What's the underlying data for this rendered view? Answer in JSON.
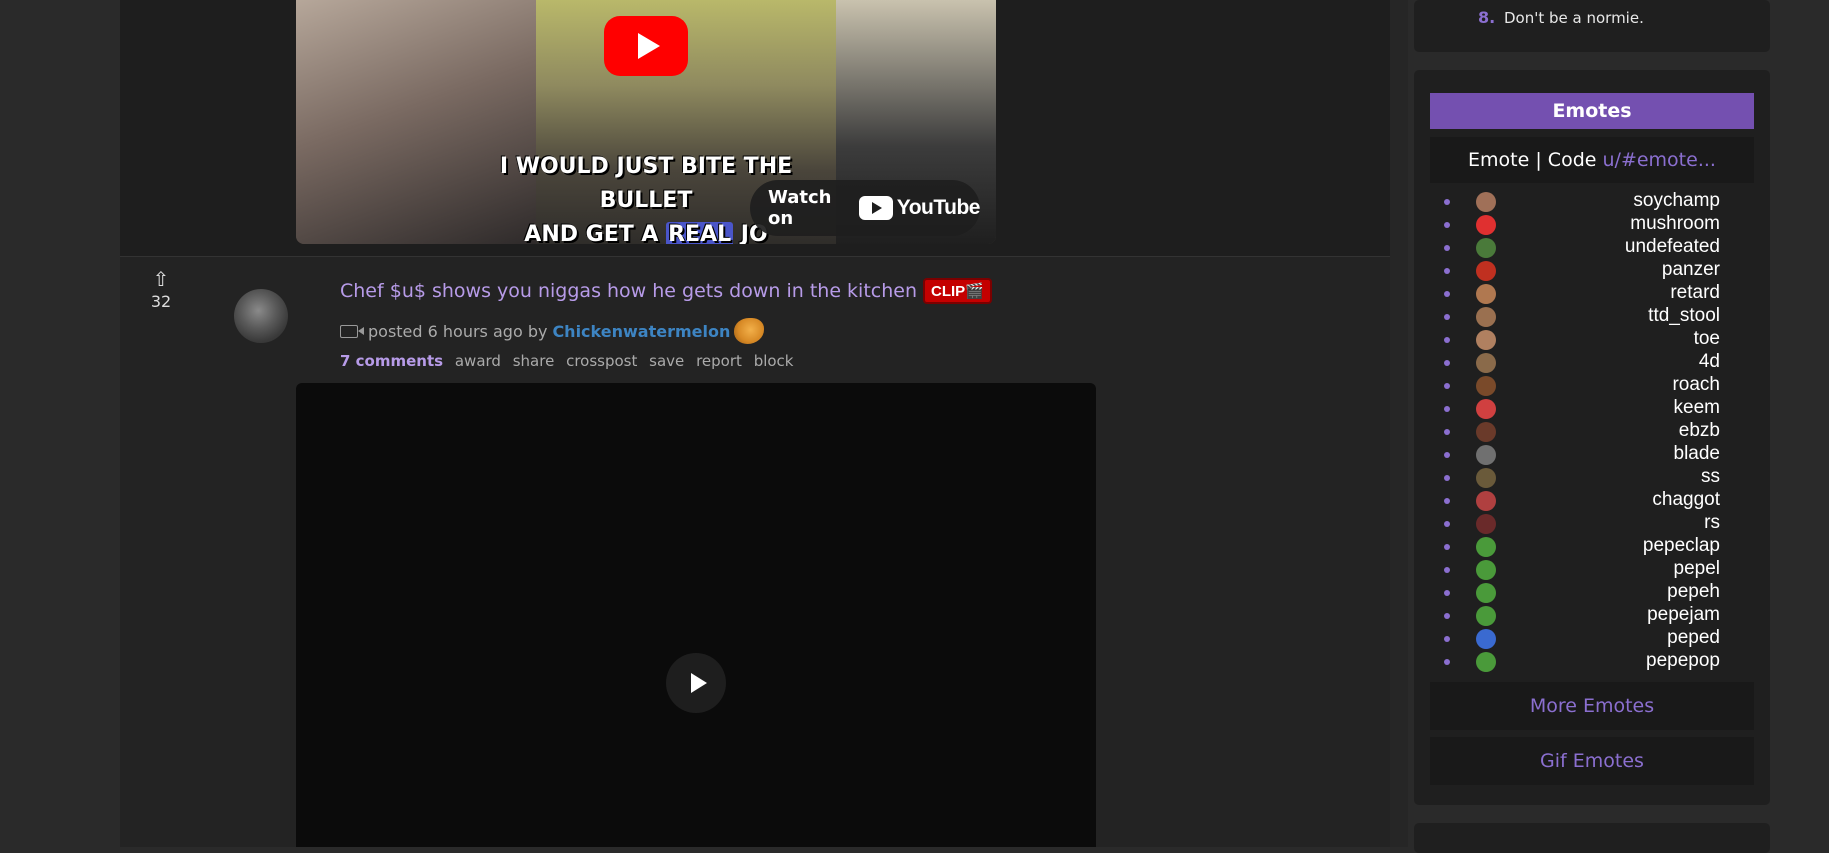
{
  "prev_post": {
    "video": {
      "caption_line1": "I WOULD JUST BITE THE BULLET",
      "caption_line2_pre": "AND GET A",
      "caption_line2_hl": "REAL",
      "caption_line2_post": "JO",
      "watch_on_label": "Watch on",
      "youtube_label": "YouTube",
      "play_icon": "youtube-play-icon"
    }
  },
  "post": {
    "score": "32",
    "upvote_icon": "upvote-arrow-icon",
    "title": "Chef $u$ shows you niggas how he gets down in the kitchen",
    "flair": "CLIP🎬",
    "tagline": {
      "posted": "posted 6 hours ago by",
      "author": "Chickenwatermelon"
    },
    "buttons": {
      "comments": "7 comments",
      "award": "award",
      "share": "share",
      "crosspost": "crosspost",
      "save": "save",
      "report": "report",
      "block": "block"
    }
  },
  "sidebar": {
    "rule": {
      "num": "8.",
      "text": "Don't be a normie."
    },
    "emotes": {
      "header": "Emotes",
      "code_label": "Emote | Code ",
      "code_link": "u/#emote...",
      "items": [
        {
          "name": "soychamp",
          "color": "#a07058"
        },
        {
          "name": "mushroom",
          "color": "#e03030"
        },
        {
          "name": "undefeated",
          "color": "#4a7a3a"
        },
        {
          "name": "panzer",
          "color": "#c03020"
        },
        {
          "name": "retard",
          "color": "#b07850"
        },
        {
          "name": "ttd_stool",
          "color": "#9a7050"
        },
        {
          "name": "toe",
          "color": "#b08060"
        },
        {
          "name": "4d",
          "color": "#8a6a4a"
        },
        {
          "name": "roach",
          "color": "#7a4a2a"
        },
        {
          "name": "keem",
          "color": "#d04040"
        },
        {
          "name": "ebzb",
          "color": "#6a3a2a"
        },
        {
          "name": "blade",
          "color": "#707070"
        },
        {
          "name": "ss",
          "color": "#6a5a3a"
        },
        {
          "name": "chaggot",
          "color": "#b04040"
        },
        {
          "name": "rs",
          "color": "#6a2a2a"
        },
        {
          "name": "pepeclap",
          "color": "#4a9a3a"
        },
        {
          "name": "pepel",
          "color": "#4a9a3a"
        },
        {
          "name": "pepeh",
          "color": "#4a9a3a"
        },
        {
          "name": "pepejam",
          "color": "#4a9a3a"
        },
        {
          "name": "peped",
          "color": "#3a6ad0"
        },
        {
          "name": "pepepop",
          "color": "#4a9a3a"
        }
      ],
      "more_label": "More Emotes",
      "gif_label": "Gif Emotes"
    }
  }
}
